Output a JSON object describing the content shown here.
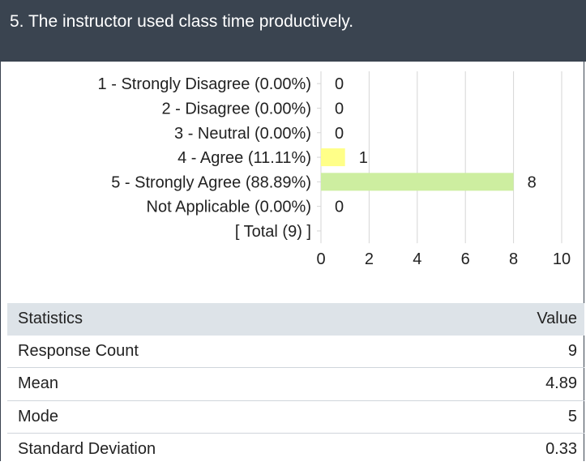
{
  "question": {
    "title": "5. The instructor used class time productively."
  },
  "chart_data": {
    "type": "bar",
    "orientation": "horizontal",
    "categories": [
      "1 - Strongly Disagree (0.00%)",
      "2 - Disagree (0.00%)",
      "3 - Neutral (0.00%)",
      "4 - Agree (11.11%)",
      "5 - Strongly Agree (88.89%)",
      "Not Applicable (0.00%)",
      "[ Total (9) ]"
    ],
    "values": [
      0,
      0,
      0,
      1,
      8,
      0,
      null
    ],
    "value_labels": [
      "0",
      "0",
      "0",
      "1",
      "8",
      "0",
      ""
    ],
    "bar_colors": [
      "#ffff88",
      "#ffff88",
      "#ffff88",
      "#ffff88",
      "#cdeea0",
      "#ffff88",
      "#ffff88"
    ],
    "xlim": [
      0,
      10
    ],
    "xticks": [
      "0",
      "2",
      "4",
      "6",
      "8",
      "10"
    ],
    "grid": true,
    "title": "",
    "xlabel": "",
    "ylabel": ""
  },
  "stats": {
    "header": {
      "label": "Statistics",
      "value": "Value"
    },
    "rows": [
      {
        "label": "Response Count",
        "value": "9"
      },
      {
        "label": "Mean",
        "value": "4.89"
      },
      {
        "label": "Mode",
        "value": "5"
      },
      {
        "label": "Standard Deviation",
        "value": "0.33"
      }
    ]
  }
}
